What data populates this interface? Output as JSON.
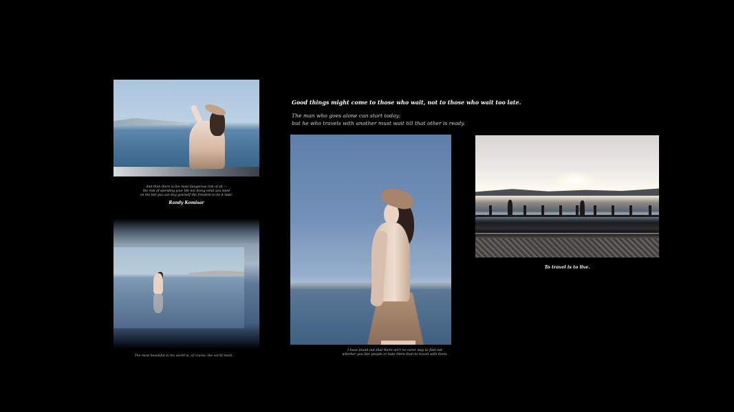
{
  "captions": {
    "photo1": {
      "lines": [
        "And then there is the most dangerous risk of all —",
        "the risk of spending your life not doing what you want",
        "on the bet you can buy yourself the freedom to do it later."
      ],
      "author": "Randy Komisar"
    },
    "photo2": "The most beautiful in the world is, of course, the world itself.",
    "photo3": [
      "I have found out that there ain't no surer way to find out",
      "whether you like people or hate them than to travel with them."
    ],
    "photo4": "To travel is to live."
  },
  "quote": {
    "title": "Good things might come to those who wait, not to those who wait too late.",
    "lines": [
      "The man who goes alone can start today;",
      "but he who travels with another must wait till that other is ready."
    ]
  }
}
